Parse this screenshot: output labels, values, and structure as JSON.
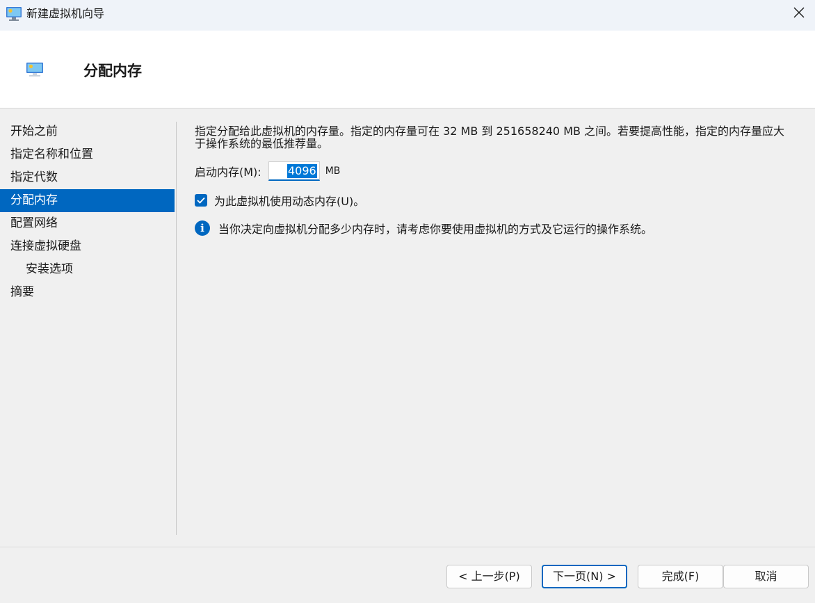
{
  "window": {
    "title": "新建虚拟机向导",
    "app_icon": "vm-monitor-icon",
    "close_icon": "close-icon"
  },
  "header": {
    "title": "分配内存",
    "icon": "vm-monitor-icon"
  },
  "sidebar": {
    "items": [
      {
        "label": "开始之前",
        "active": false,
        "sub": false
      },
      {
        "label": "指定名称和位置",
        "active": false,
        "sub": false
      },
      {
        "label": "指定代数",
        "active": false,
        "sub": false
      },
      {
        "label": "分配内存",
        "active": true,
        "sub": false
      },
      {
        "label": "配置网络",
        "active": false,
        "sub": false
      },
      {
        "label": "连接虚拟硬盘",
        "active": false,
        "sub": false
      },
      {
        "label": "安装选项",
        "active": false,
        "sub": true
      },
      {
        "label": "摘要",
        "active": false,
        "sub": false
      }
    ]
  },
  "main": {
    "description": "指定分配给此虚拟机的内存量。指定的内存量可在 32 MB 到 251658240 MB 之间。若要提高性能，指定的内存量应大于操作系统的最低推荐量。",
    "startup_memory_label": "启动内存(M):",
    "startup_memory_value": "4096",
    "memory_unit": "MB",
    "dynamic_memory_label": "为此虚拟机使用动态内存(U)。",
    "dynamic_memory_checked": true,
    "info_text": "当你决定向虚拟机分配多少内存时，请考虑你要使用虚拟机的方式及它运行的操作系统。",
    "info_icon": "info-icon"
  },
  "footer": {
    "back_label": "< 上一步(P)",
    "next_label": "下一页(N) >",
    "finish_label": "完成(F)",
    "cancel_label": "取消"
  },
  "colors": {
    "accent": "#0067c0",
    "selection": "#0078d7",
    "titlebar_bg": "#eff3f9",
    "window_bg": "#f0f0f0"
  }
}
